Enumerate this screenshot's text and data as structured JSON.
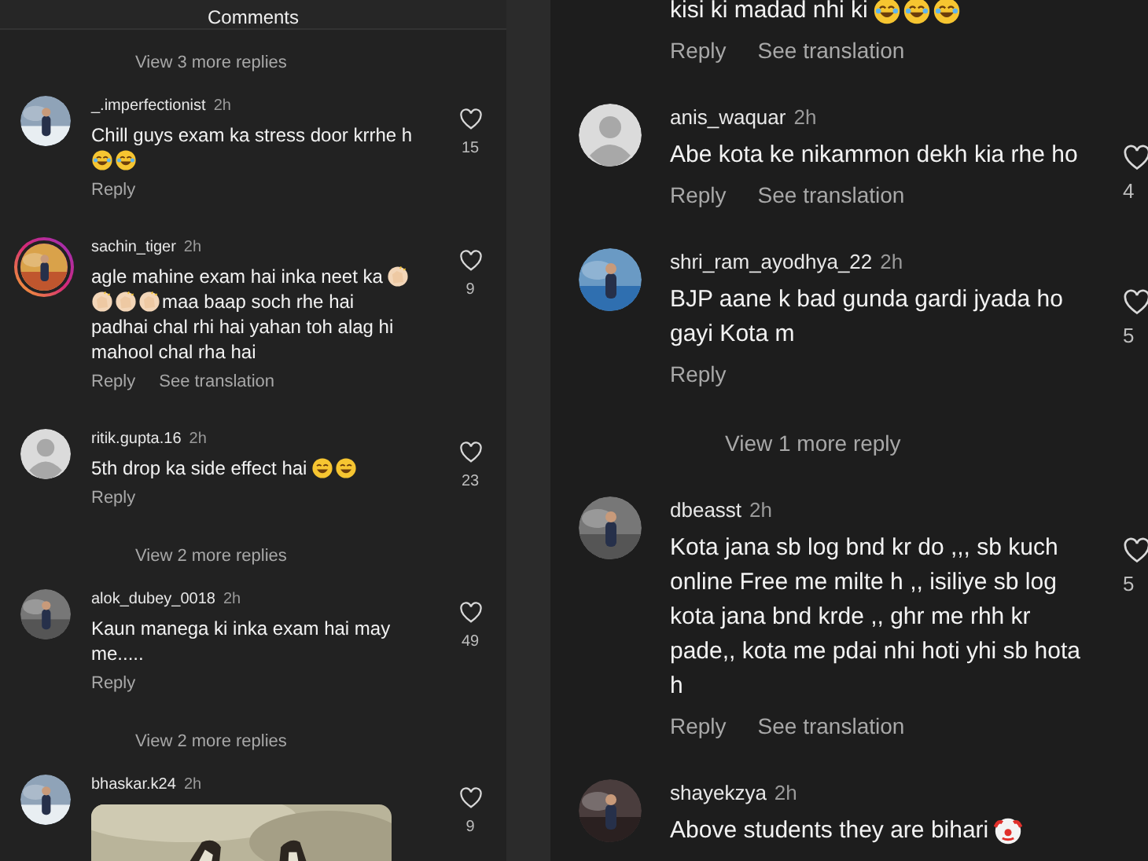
{
  "panels": [
    {
      "header": "Comments",
      "items": [
        {
          "kind": "more",
          "text": "View 3 more replies"
        },
        {
          "kind": "comment",
          "username": "_.imperfectionist",
          "time": "2h",
          "avatar": {
            "kind": "picture"
          },
          "story": false,
          "body": [
            {
              "kind": "text",
              "text": "Chill guys exam ka stress door krrhe h"
            },
            {
              "kind": "laugh_emoji"
            },
            {
              "kind": "laugh_emoji"
            }
          ],
          "actions": [
            "Reply"
          ],
          "likes": "15"
        },
        {
          "kind": "comment",
          "username": "sachin_tiger",
          "time": "2h",
          "avatar": {
            "kind": "picture"
          },
          "story": true,
          "body": [
            {
              "kind": "text",
              "text": "agle mahine exam hai inka neet ka"
            },
            {
              "kind": "clap_emoji"
            },
            {
              "kind": "clap_emoji"
            },
            {
              "kind": "clap_emoji"
            },
            {
              "kind": "clap_emoji"
            },
            {
              "kind": "text",
              "text": "maa baap soch rhe hai"
            },
            {
              "kind": "text",
              "text": "padhai chal rhi hai yahan toh alag hi mahool chal rha hai"
            }
          ],
          "actions": [
            "Reply",
            "See translation"
          ],
          "likes": "9"
        },
        {
          "kind": "comment",
          "username": "ritik.gupta.16",
          "time": "2h",
          "avatar": {
            "kind": "default"
          },
          "story": false,
          "body": [
            {
              "kind": "text",
              "text": "5th drop ka side effect hai"
            },
            {
              "kind": "sleepy_emoji"
            },
            {
              "kind": "grin_emoji"
            }
          ],
          "actions": [
            "Reply"
          ],
          "likes": "23"
        },
        {
          "kind": "more",
          "text": "View 2 more replies"
        },
        {
          "kind": "comment",
          "username": "alok_dubey_0018",
          "time": "2h",
          "avatar": {
            "kind": "picture"
          },
          "story": false,
          "body": [
            {
              "kind": "text",
              "text": "Kaun manega ki inka exam hai may me....."
            }
          ],
          "actions": [
            "Reply"
          ],
          "likes": "49"
        },
        {
          "kind": "more",
          "text": "View 2 more replies"
        },
        {
          "kind": "comment",
          "username": "bhaskar.k24",
          "time": "2h",
          "avatar": {
            "kind": "picture"
          },
          "story": false,
          "attachment": {
            "kind": "picture"
          },
          "likes": "9"
        }
      ]
    },
    {
      "items": [
        {
          "kind": "comment",
          "body": [
            {
              "kind": "text",
              "text": "kisi ki madad nhi ki"
            },
            {
              "kind": "laugh_emoji"
            },
            {
              "kind": "laugh_emoji"
            },
            {
              "kind": "laugh_emoji"
            }
          ],
          "actions": [
            "Reply",
            "See translation"
          ]
        },
        {
          "kind": "comment",
          "username": "anis_waquar",
          "time": "2h",
          "avatar": {
            "kind": "default"
          },
          "story": false,
          "body": [
            {
              "kind": "text",
              "text": "Abe kota ke nikammon dekh kia rhe ho"
            }
          ],
          "actions": [
            "Reply",
            "See translation"
          ],
          "likes": "4"
        },
        {
          "kind": "comment",
          "username": "shri_ram_ayodhya_22",
          "time": "2h",
          "avatar": {
            "kind": "picture"
          },
          "story": false,
          "body": [
            {
              "kind": "text",
              "text": "BJP aane k bad gunda gardi jyada ho gayi Kota m"
            }
          ],
          "actions": [
            "Reply"
          ],
          "likes": "5"
        },
        {
          "kind": "more",
          "text": "View 1 more reply"
        },
        {
          "kind": "comment",
          "username": "dbeasst",
          "time": "2h",
          "avatar": {
            "kind": "picture"
          },
          "story": false,
          "body": [
            {
              "kind": "text",
              "text": "Kota jana sb log bnd kr do ,,, sb kuch online Free me milte h ,, isiliye sb log kota jana bnd krde ,, ghr me rhh kr pade,, kota me pdai nhi hoti yhi sb hota h"
            }
          ],
          "actions": [
            "Reply",
            "See translation"
          ],
          "likes": "5"
        },
        {
          "kind": "comment",
          "username": "shayekzya",
          "time": "2h",
          "avatar": {
            "kind": "picture"
          },
          "story": false,
          "body": [
            {
              "kind": "text",
              "text": "Above students they are bihari"
            },
            {
              "kind": "clown_emoji"
            }
          ]
        }
      ]
    }
  ]
}
